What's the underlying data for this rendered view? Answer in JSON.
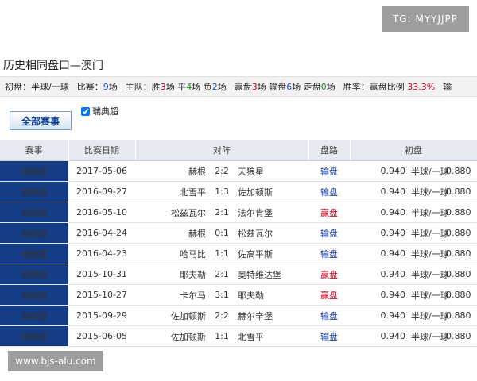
{
  "watermark_top": "TG: MYYJJPP",
  "watermark_bottom": "www.bjs-alu.com",
  "page_title": "历史相同盘口—澳门",
  "summary": {
    "initial_label": "初盘：",
    "initial_value": "半球/一球",
    "matches_label": "比赛：",
    "matches_count": "9",
    "matches_unit": "场",
    "home_label": "主队：",
    "win_label": "胜",
    "win_count": "3",
    "win_unit": "场",
    "draw_label": "平",
    "draw_count": "4",
    "draw_unit": "场",
    "loss_label": "负",
    "loss_count": "2",
    "loss_unit": "场",
    "win_pan_label": "赢盘",
    "win_pan_count": "3",
    "win_pan_unit": "场",
    "lose_pan_label": "输盘",
    "lose_pan_count": "6",
    "lose_pan_unit": "场",
    "push_label": "走盘",
    "push_count": "0",
    "push_unit": "场",
    "rate_label": "胜率：",
    "ratio_label": "赢盘比例",
    "ratio_value": "33.3%",
    "trailing": "输"
  },
  "all_matches_button": "全部赛事",
  "filter_label": "瑞典超",
  "columns": {
    "league": "赛事",
    "date": "比赛日期",
    "matchup": "对阵",
    "result": "盘路",
    "initial": "初盘"
  },
  "rows": [
    {
      "league": "瑞典超",
      "date": "2017-05-06",
      "home": "赫根",
      "score": "2:2",
      "away": "天狼星",
      "result": "输盘",
      "odd1": "0.940",
      "handicap": "半球/一球",
      "odd2": "0.880"
    },
    {
      "league": "瑞典超",
      "date": "2016-09-27",
      "home": "北雪平",
      "score": "1:3",
      "away": "佐加顿斯",
      "result": "输盘",
      "odd1": "0.940",
      "handicap": "半球/一球",
      "odd2": "0.880"
    },
    {
      "league": "瑞典超",
      "date": "2016-05-10",
      "home": "松兹瓦尔",
      "score": "2:1",
      "away": "法尔肯堡",
      "result": "赢盘",
      "odd1": "0.940",
      "handicap": "半球/一球",
      "odd2": "0.880"
    },
    {
      "league": "瑞典超",
      "date": "2016-04-24",
      "home": "赫根",
      "score": "0:1",
      "away": "松兹瓦尔",
      "result": "输盘",
      "odd1": "0.940",
      "handicap": "半球/一球",
      "odd2": "0.880"
    },
    {
      "league": "瑞典超",
      "date": "2016-04-23",
      "home": "哈马比",
      "score": "1:1",
      "away": "佐高平斯",
      "result": "输盘",
      "odd1": "0.940",
      "handicap": "半球/一球",
      "odd2": "0.880"
    },
    {
      "league": "瑞典超",
      "date": "2015-10-31",
      "home": "耶夫勒",
      "score": "2:1",
      "away": "奥特维达堡",
      "result": "赢盘",
      "odd1": "0.940",
      "handicap": "半球/一球",
      "odd2": "0.880"
    },
    {
      "league": "瑞典超",
      "date": "2015-10-27",
      "home": "卡尔马",
      "score": "3:1",
      "away": "耶夫勒",
      "result": "赢盘",
      "odd1": "0.940",
      "handicap": "半球/一球",
      "odd2": "0.880"
    },
    {
      "league": "瑞典超",
      "date": "2015-09-29",
      "home": "佐加顿斯",
      "score": "2:2",
      "away": "赫尔辛堡",
      "result": "输盘",
      "odd1": "0.940",
      "handicap": "半球/一球",
      "odd2": "0.880"
    },
    {
      "league": "瑞典超",
      "date": "2015-06-05",
      "home": "佐加顿斯",
      "score": "1:1",
      "away": "北雪平",
      "result": "输盘",
      "odd1": "0.940",
      "handicap": "半球/一球",
      "odd2": "0.880"
    }
  ]
}
